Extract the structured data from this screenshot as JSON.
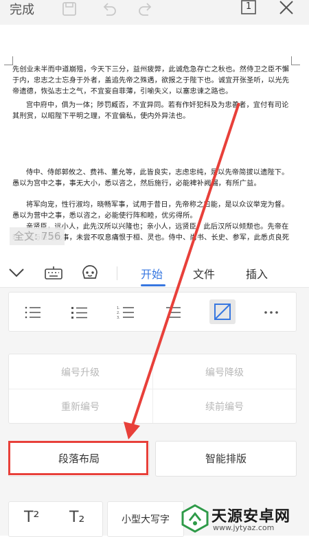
{
  "topbar": {
    "done_label": "完成",
    "page_number": "1"
  },
  "document": {
    "paragraphs": [
      "先创业未半而中道崩殂，今天下三分，益州疲弊，此诚危急存亡之秋也。然侍卫之臣不懈于内，忠志之士忘身于外者，盖追先帝之殊遇，欲报之于陛下也。诚宜开张圣听，以光先帝遗德，恢弘志士之气，不宜妄自菲薄，引喻失义，以塞忠谏之路也。",
      "宫中府中，俱为一体；陟罚臧否，不宜异同。若有作奸犯科及为忠善者，宜付有司论其刑赏，以昭陛下平明之理，不宜偏私，使内外异法也。",
      "侍中、侍郎郭攸之、费祎、董允等，此皆良实，志虑忠纯，是以先帝简拔以遗陛下。愚以为宫中之事，事无大小，悉以咨之，然后施行，必能裨补阙漏，有所广益。",
      "将军向宠，性行淑均，晓畅军事，试用于昔日，先帝称之曰能，是以众议举宠为督。愚以为营中之事，悉以咨之，必能使行阵和睦，优劣得所。",
      "亲贤臣，远小人，此先汉所以兴隆也；亲小人，远贤臣，此后汉所以倾颓也。先帝在时，每与臣论此事，未尝不叹息痛恨于桓、灵也。侍中、尚书、长史、参军，此悉贞良死节之臣，愿陛下亲之信之，则汉室之隆，可计日而待也。"
    ],
    "word_count": "全文: 756"
  },
  "toolbar": {
    "tabs": [
      {
        "label": "开始"
      },
      {
        "label": "文件"
      },
      {
        "label": "插入"
      }
    ]
  },
  "panel": {
    "numbering": {
      "promote": "编号升级",
      "demote": "编号降级",
      "restart": "重新编号",
      "continue": "续前编号"
    },
    "paragraph_layout": "段落布局",
    "smart_layout": "智能排版",
    "superscript": "T²",
    "subscript": "T₂",
    "small_caps": "小型大写字"
  },
  "watermark": {
    "name": "天源安卓网",
    "url": "www.jytyaz.com"
  },
  "colors": {
    "accent": "#3777e0",
    "highlight": "#e8403a"
  }
}
